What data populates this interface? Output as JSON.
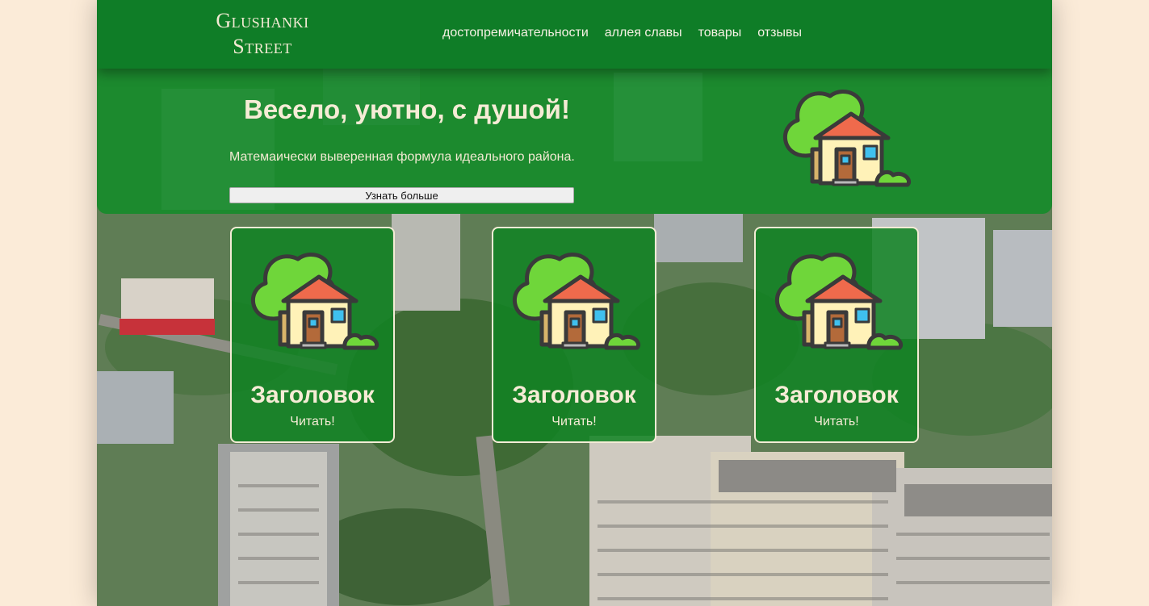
{
  "logo": {
    "line1": "Glushanki",
    "line2": "Street"
  },
  "nav": {
    "items": [
      {
        "label": "достопремичательности"
      },
      {
        "label": "аллея славы"
      },
      {
        "label": "товары"
      },
      {
        "label": "отзывы"
      }
    ]
  },
  "hero": {
    "title": "Весело, уютно, с душой!",
    "subtitle": "Матемаически выверенная формула идеального района.",
    "button_label": "Узнать больше",
    "icon": "house-with-tree-icon"
  },
  "cards": [
    {
      "title": "Заголовок",
      "link": "Читать!",
      "icon": "house-with-tree-icon"
    },
    {
      "title": "Заголовок",
      "link": "Читать!",
      "icon": "house-with-tree-icon"
    },
    {
      "title": "Заголовок",
      "link": "Читать!",
      "icon": "house-with-tree-icon"
    }
  ],
  "colors": {
    "page_background": "#fbebd8",
    "navbar": "#0f7d27",
    "hero": "#128c28",
    "text_light": "#f6ecd6"
  }
}
